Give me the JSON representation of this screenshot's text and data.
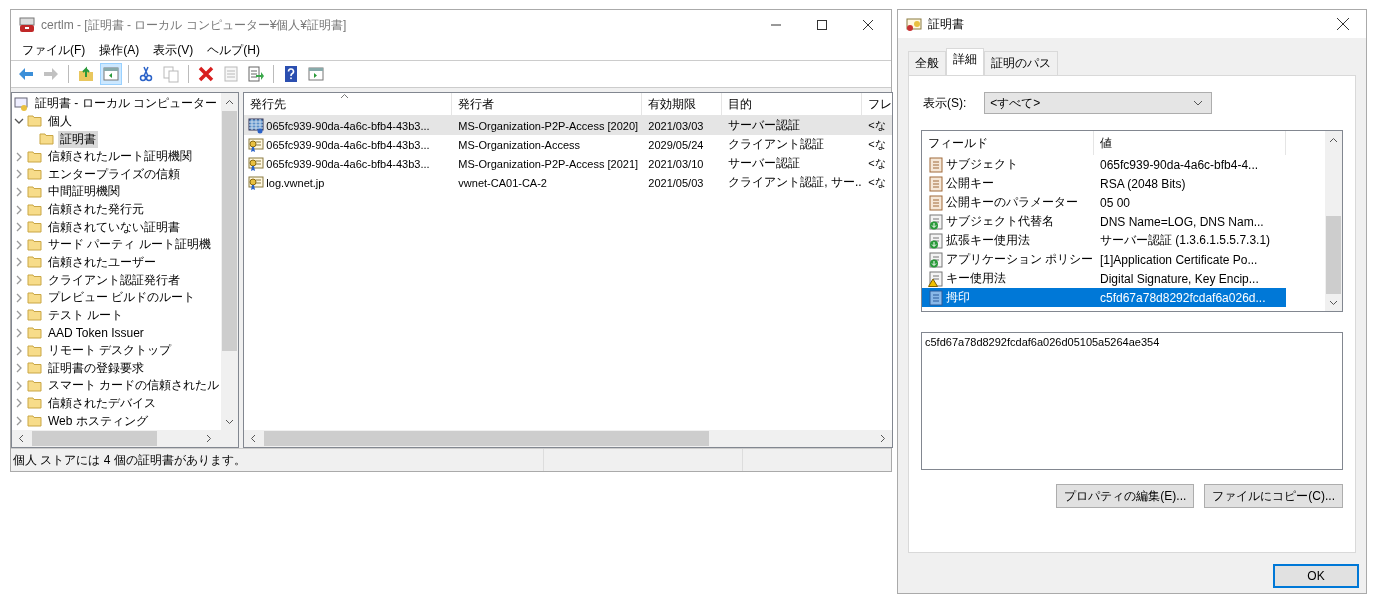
{
  "main_window": {
    "title": "certlm - [証明書 - ローカル コンピューター¥個人¥証明書]",
    "menu": [
      "ファイル(F)",
      "操作(A)",
      "表示(V)",
      "ヘルプ(H)"
    ],
    "toolbar": [
      {
        "kind": "back",
        "disabled": false,
        "pressed": false
      },
      {
        "kind": "forward",
        "disabled": true,
        "pressed": false
      },
      {
        "kind": "up",
        "disabled": false,
        "pressed": false
      },
      {
        "kind": "tree",
        "disabled": false,
        "pressed": true
      },
      {
        "kind": "cut",
        "disabled": false,
        "pressed": false
      },
      {
        "kind": "copy",
        "disabled": true,
        "pressed": false
      },
      {
        "kind": "delete",
        "disabled": false,
        "pressed": false
      },
      {
        "kind": "properties",
        "disabled": true,
        "pressed": false
      },
      {
        "kind": "export",
        "disabled": false,
        "pressed": false
      },
      {
        "kind": "help",
        "disabled": false,
        "pressed": false
      },
      {
        "kind": "view",
        "disabled": false,
        "pressed": false
      }
    ],
    "tree": {
      "label": "証明書 - ローカル コンピューター",
      "children": [
        {
          "label": "個人",
          "expanded": true,
          "selected": false,
          "children": [
            {
              "label": "証明書",
              "selected": true
            }
          ]
        },
        {
          "label": "信頼されたルート証明機関",
          "expanded": false,
          "selected": false
        },
        {
          "label": "エンタープライズの信頼",
          "expanded": false,
          "selected": false
        },
        {
          "label": "中間証明機関",
          "expanded": false,
          "selected": false
        },
        {
          "label": "信頼された発行元",
          "expanded": false,
          "selected": false
        },
        {
          "label": "信頼されていない証明書",
          "expanded": false,
          "selected": false
        },
        {
          "label": "サード パーティ ルート証明機",
          "expanded": false,
          "selected": false
        },
        {
          "label": "信頼されたユーザー",
          "expanded": false,
          "selected": false
        },
        {
          "label": "クライアント認証発行者",
          "expanded": false,
          "selected": false
        },
        {
          "label": "プレビュー ビルドのルート",
          "expanded": false,
          "selected": false
        },
        {
          "label": "テスト ルート",
          "expanded": false,
          "selected": false
        },
        {
          "label": "AAD Token Issuer",
          "expanded": false,
          "selected": false
        },
        {
          "label": "リモート デスクトップ",
          "expanded": false,
          "selected": false
        },
        {
          "label": "証明書の登録要求",
          "expanded": false,
          "selected": false
        },
        {
          "label": "スマート カードの信頼されたル",
          "expanded": false,
          "selected": false
        },
        {
          "label": "信頼されたデバイス",
          "expanded": false,
          "selected": false
        },
        {
          "label": "Web ホスティング",
          "expanded": false,
          "selected": false
        }
      ]
    },
    "table": {
      "columns": [
        "発行先",
        "発行者",
        "有効期限",
        "目的",
        "フレ"
      ],
      "rows": [
        {
          "kind": "pending",
          "selected": true,
          "cells": [
            "065fc939-90da-4a6c-bfb4-43b3...",
            "MS-Organization-P2P-Access [2020]",
            "2021/03/03",
            "サーバー認証",
            "<な"
          ]
        },
        {
          "kind": "cert",
          "selected": false,
          "cells": [
            "065fc939-90da-4a6c-bfb4-43b3...",
            "MS-Organization-Access",
            "2029/05/24",
            "クライアント認証",
            "<な"
          ]
        },
        {
          "kind": "cert",
          "selected": false,
          "cells": [
            "065fc939-90da-4a6c-bfb4-43b3...",
            "MS-Organization-P2P-Access [2021]",
            "2021/03/10",
            "サーバー認証",
            "<な"
          ]
        },
        {
          "kind": "cert",
          "selected": false,
          "cells": [
            "log.vwnet.jp",
            "vwnet-CA01-CA-2",
            "2021/05/03",
            "クライアント認証, サー...",
            "<な"
          ]
        }
      ]
    },
    "status_bar": "個人 ストアには 4 個の証明書があります。"
  },
  "dialog": {
    "title": "証明書",
    "tabs": [
      {
        "label": "全般",
        "selected": false
      },
      {
        "label": "詳細",
        "selected": true
      },
      {
        "label": "証明のパス",
        "selected": false
      }
    ],
    "show_label": "表示(S):",
    "show_value": "<すべて>",
    "fields": {
      "columns": [
        "フィールド",
        "値"
      ],
      "rows": [
        {
          "kind": "field",
          "selected": false,
          "name": "サブジェクト",
          "value": "065fc939-90da-4a6c-bfb4-4..."
        },
        {
          "kind": "field",
          "selected": false,
          "name": "公開キー",
          "value": "RSA (2048 Bits)"
        },
        {
          "kind": "field",
          "selected": false,
          "name": "公開キーのパラメーター",
          "value": "05 00"
        },
        {
          "kind": "extension",
          "selected": false,
          "name": "サブジェクト代替名",
          "value": "DNS Name=LOG, DNS Nam..."
        },
        {
          "kind": "extension",
          "selected": false,
          "name": "拡張キー使用法",
          "value": "サーバー認証 (1.3.6.1.5.5.7.3.1)"
        },
        {
          "kind": "extension",
          "selected": false,
          "name": "アプリケーション ポリシー",
          "value": "[1]Application Certificate Po..."
        },
        {
          "kind": "warning",
          "selected": false,
          "name": "キー使用法",
          "value": "Digital Signature, Key Encip..."
        },
        {
          "kind": "field",
          "selected": true,
          "name": "拇印",
          "value": "c5fd67a78d8292fcdaf6a026d..."
        }
      ]
    },
    "detail_text": "c5fd67a78d8292fcdaf6a026d05105a5264ae354",
    "buttons": [
      "プロパティの編集(E)...",
      "ファイルにコピー(C)..."
    ],
    "ok_button": "OK"
  }
}
